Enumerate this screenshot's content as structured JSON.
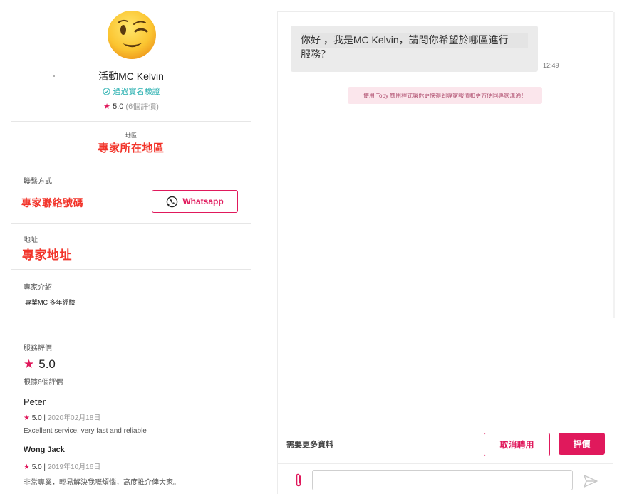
{
  "profile": {
    "name": "活動MC Kelvin",
    "verified": "通過實名驗證",
    "rating": "5.0",
    "rating_count": "(6個評價)"
  },
  "region": {
    "label": "地區",
    "value": "專家所在地區"
  },
  "contact": {
    "label": "聯繫方式",
    "value": "專家聯絡號碼",
    "whatsapp_label": "Whatsapp"
  },
  "address": {
    "label": "地址",
    "value": "專家地址"
  },
  "intro": {
    "label": "專家介紹",
    "value": "專業MC 多年經驗"
  },
  "service_rating": {
    "label": "服務評價",
    "score": "5.0",
    "count_text": "根據6個評價",
    "reviews": [
      {
        "name": "Peter",
        "score": "5.0",
        "date": "2020年02月18日",
        "text": "Excellent service, very fast and reliable"
      },
      {
        "name": "Wong Jack",
        "score": "5.0",
        "date": "2019年10月16日",
        "text": "非常專業，輕易解決我嘅煩惱，高度推介俾大家。"
      }
    ]
  },
  "chat": {
    "message_line1": "你好 ，我是MC Kelvin，請問你希望於哪區進行",
    "message_line2": "服務？",
    "time": "12:49",
    "notice": "使用 Toby 應用程式讓你更快得到專家報價和更方便同專家溝通！",
    "need_more": "需要更多資料",
    "cancel_label": "取消聘用",
    "rate_label": "評價",
    "input_placeholder": ""
  },
  "colors": {
    "accent": "#e0195c",
    "verified": "#2ab0b0",
    "handwritten": "#f2352b",
    "notice_bg": "#fbe6ec"
  },
  "icons": [
    "winking-face-emoji",
    "check-circle-icon",
    "star-icon",
    "whatsapp-icon",
    "paperclip-icon",
    "send-icon"
  ]
}
